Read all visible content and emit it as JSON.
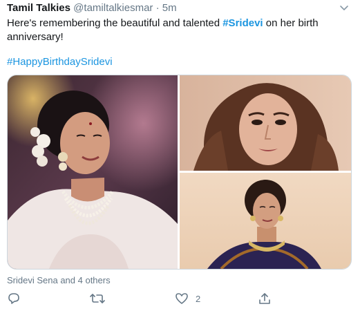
{
  "tweet": {
    "display_name": "Tamil Talkies",
    "handle": "@tamiltalkiesmar",
    "separator": "·",
    "time": "5m",
    "text_before": "Here's remembering the beautiful and talented ",
    "hashtag_inline": "#Sridevi",
    "text_after": " on her birth anniversary!",
    "hashtag_line": "#HappyBirthdaySridevi",
    "liked_by": "Sridevi Sena and 4 others",
    "like_count": "2"
  },
  "icons": {
    "caret": "chevron-down-icon",
    "reply": "reply-icon",
    "retweet": "retweet-icon",
    "like": "heart-icon",
    "share": "share-icon"
  },
  "colors": {
    "link": "#1b95e0",
    "secondary": "#657786",
    "text": "#14171a"
  }
}
